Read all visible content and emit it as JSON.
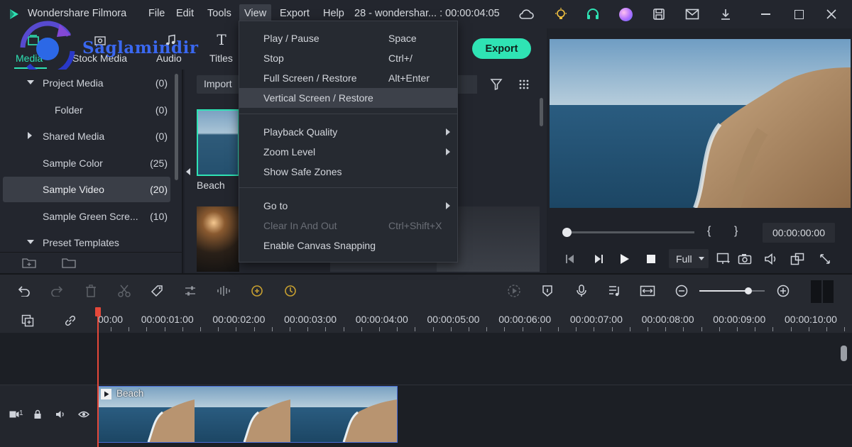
{
  "app": {
    "name": "Wondershare Filmora",
    "project_title": "28 - wondershar... : 00:00:04:05"
  },
  "menubar": [
    "File",
    "Edit",
    "Tools",
    "View",
    "Export",
    "Help"
  ],
  "watermark": "Saglamindir",
  "media_tabs": {
    "media": "Media",
    "stock_media": "Stock Media",
    "audio": "Audio",
    "titles": "Titles"
  },
  "export_label": "Export",
  "tree": [
    {
      "label": "Project Media",
      "count": "(0)",
      "expand": "down"
    },
    {
      "label": "Folder",
      "count": "(0)",
      "expand": "none"
    },
    {
      "label": "Shared Media",
      "count": "(0)",
      "expand": "right"
    },
    {
      "label": "Sample Color",
      "count": "(25)",
      "expand": "none"
    },
    {
      "label": "Sample Video",
      "count": "(20)",
      "expand": "none",
      "selected": true
    },
    {
      "label": "Sample Green Scre...",
      "count": "(10)",
      "expand": "none"
    },
    {
      "label": "Preset Templates",
      "count": "",
      "expand": "down"
    }
  ],
  "grid": {
    "import_label": "Import",
    "thumb_label": "Beach"
  },
  "view_menu": [
    {
      "label": "Play / Pause",
      "key": "Space"
    },
    {
      "label": "Stop",
      "key": "Ctrl+/"
    },
    {
      "label": "Full Screen / Restore",
      "key": "Alt+Enter"
    },
    {
      "label": "Vertical Screen / Restore",
      "key": "",
      "highlighted": true
    },
    {
      "label": "Playback Quality",
      "key": "",
      "submenu": true
    },
    {
      "label": "Zoom Level",
      "key": "",
      "submenu": true
    },
    {
      "label": "Show Safe Zones",
      "key": ""
    },
    {
      "label": "Go to",
      "key": "",
      "submenu": true
    },
    {
      "label": "Clear In And Out",
      "key": "Ctrl+Shift+X",
      "disabled": true
    },
    {
      "label": "Enable Canvas Snapping",
      "key": ""
    }
  ],
  "preview": {
    "timecode": "00:00:00:00",
    "mark_in": "{",
    "mark_out": "}",
    "quality": "Full",
    "progress": 0
  },
  "ruler": [
    "00:00",
    "00:00:01:00",
    "00:00:02:00",
    "00:00:03:00",
    "00:00:04:00",
    "00:00:05:00",
    "00:00:06:00",
    "00:00:07:00",
    "00:00:08:00",
    "00:00:09:00",
    "00:00:10:00"
  ],
  "track": {
    "number": "1",
    "clip_label": "Beach"
  },
  "colors": {
    "accent": "#2fe3b4",
    "bg": "#1e2128",
    "playhead": "#e5483a",
    "clip_border": "#4a6fd8"
  }
}
